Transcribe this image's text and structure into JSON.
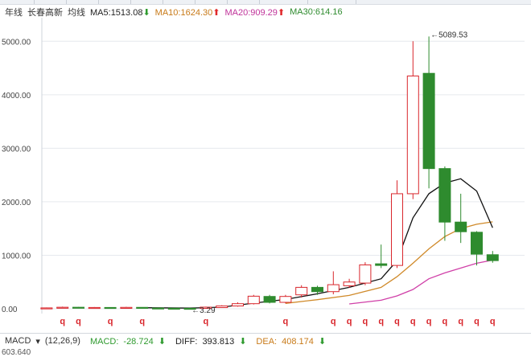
{
  "header": {
    "period": "年线",
    "stock": "长春高新",
    "indicator": "均线",
    "ma5": {
      "label": "MA5:",
      "value": "1513.08",
      "dir": "down"
    },
    "ma10": {
      "label": "MA10:",
      "value": "1624.30",
      "dir": "up"
    },
    "ma20": {
      "label": "MA20:",
      "value": "909.29",
      "dir": "up"
    },
    "ma30": {
      "label": "MA30:",
      "value": "614.16",
      "dir": ""
    }
  },
  "macd": {
    "name": "MACD",
    "params": "(12,26,9)",
    "macd_label": "MACD:",
    "macd_value": "-28.724",
    "macd_dir": "down",
    "diff_label": "DIFF:",
    "diff_value": "393.813",
    "diff_dir": "down",
    "dea_label": "DEA:",
    "dea_value": "408.174",
    "dea_dir": "down",
    "axis_top": "603.640"
  },
  "colors": {
    "up": "#d9262c",
    "down": "#2e8b2e",
    "up_fill": "#ffffff",
    "ma5": "#111111",
    "ma10": "#d08a2a",
    "ma20": "#d040a8",
    "grid": "#e6e9ee"
  },
  "chart_data": {
    "type": "candlestick",
    "title": "长春高新 年线",
    "ylim": [
      -30,
      5350
    ],
    "yticks": [
      0,
      1000,
      2000,
      3000,
      4000,
      5000
    ],
    "ytick_labels": [
      "0.00",
      "1000.00",
      "2000.00",
      "3000.00",
      "4000.00",
      "5000.00"
    ],
    "grid": true,
    "candles": [
      {
        "o": 8,
        "c": 16,
        "h": 24,
        "l": 4
      },
      {
        "o": 16,
        "c": 28,
        "h": 40,
        "l": 10
      },
      {
        "o": 28,
        "c": 20,
        "h": 34,
        "l": 14
      },
      {
        "o": 20,
        "c": 24,
        "h": 32,
        "l": 16
      },
      {
        "o": 24,
        "c": 18,
        "h": 28,
        "l": 10
      },
      {
        "o": 18,
        "c": 26,
        "h": 36,
        "l": 12
      },
      {
        "o": 26,
        "c": 14,
        "h": 30,
        "l": 8
      },
      {
        "o": 14,
        "c": 10,
        "h": 18,
        "l": 6
      },
      {
        "o": 10,
        "c": 8,
        "h": 14,
        "l": 4
      },
      {
        "o": 8,
        "c": 5,
        "h": 10,
        "l": 3.29
      },
      {
        "o": 8,
        "c": 30,
        "h": 40,
        "l": 6
      },
      {
        "o": 22,
        "c": 52,
        "h": 66,
        "l": 16
      },
      {
        "o": 52,
        "c": 95,
        "h": 120,
        "l": 40
      },
      {
        "o": 95,
        "c": 235,
        "h": 260,
        "l": 80
      },
      {
        "o": 230,
        "c": 120,
        "h": 260,
        "l": 100
      },
      {
        "o": 120,
        "c": 230,
        "h": 260,
        "l": 100
      },
      {
        "o": 260,
        "c": 400,
        "h": 440,
        "l": 210
      },
      {
        "o": 400,
        "c": 320,
        "h": 430,
        "l": 260
      },
      {
        "o": 320,
        "c": 450,
        "h": 700,
        "l": 270
      },
      {
        "o": 430,
        "c": 500,
        "h": 560,
        "l": 390
      },
      {
        "o": 480,
        "c": 820,
        "h": 870,
        "l": 440
      },
      {
        "o": 840,
        "c": 810,
        "h": 1200,
        "l": 760
      },
      {
        "o": 810,
        "c": 2150,
        "h": 2400,
        "l": 760
      },
      {
        "o": 2150,
        "c": 4350,
        "h": 5000,
        "l": 2050
      },
      {
        "o": 4400,
        "c": 2620,
        "h": 5089.53,
        "l": 2250
      },
      {
        "o": 2620,
        "c": 1620,
        "h": 2660,
        "l": 1270
      },
      {
        "o": 1620,
        "c": 1440,
        "h": 2150,
        "l": 1230
      },
      {
        "o": 1430,
        "c": 1020,
        "h": 1450,
        "l": 810
      },
      {
        "o": 1010,
        "c": 900,
        "h": 1080,
        "l": 860
      }
    ],
    "ma5": [
      {
        "i": 6,
        "v": 20
      },
      {
        "i": 9,
        "v": 12
      },
      {
        "i": 11,
        "v": 30
      },
      {
        "i": 13,
        "v": 105
      },
      {
        "i": 15,
        "v": 175
      },
      {
        "i": 17,
        "v": 280
      },
      {
        "i": 19,
        "v": 400
      },
      {
        "i": 21,
        "v": 560
      },
      {
        "i": 22,
        "v": 900
      },
      {
        "i": 23,
        "v": 1700
      },
      {
        "i": 24,
        "v": 2150
      },
      {
        "i": 25,
        "v": 2350
      },
      {
        "i": 26,
        "v": 2430
      },
      {
        "i": 27,
        "v": 2200
      },
      {
        "i": 28,
        "v": 1513.08
      }
    ],
    "ma10": [
      {
        "i": 15,
        "v": 100
      },
      {
        "i": 17,
        "v": 170
      },
      {
        "i": 19,
        "v": 250
      },
      {
        "i": 21,
        "v": 400
      },
      {
        "i": 22,
        "v": 600
      },
      {
        "i": 23,
        "v": 850
      },
      {
        "i": 24,
        "v": 1120
      },
      {
        "i": 25,
        "v": 1350
      },
      {
        "i": 26,
        "v": 1500
      },
      {
        "i": 27,
        "v": 1580
      },
      {
        "i": 28,
        "v": 1624.3
      }
    ],
    "ma20": [
      {
        "i": 19,
        "v": 90
      },
      {
        "i": 21,
        "v": 160
      },
      {
        "i": 22,
        "v": 240
      },
      {
        "i": 23,
        "v": 360
      },
      {
        "i": 24,
        "v": 560
      },
      {
        "i": 25,
        "v": 670
      },
      {
        "i": 26,
        "v": 760
      },
      {
        "i": 27,
        "v": 850
      },
      {
        "i": 28,
        "v": 909.29
      }
    ],
    "annotations": [
      {
        "label": "←3.29",
        "i": 9,
        "v": 3.29
      },
      {
        "label": "←5089.53",
        "i": 24,
        "v": 5089.53
      }
    ],
    "event_marker": "q",
    "event_indices": [
      1,
      2,
      4,
      6,
      10,
      15,
      18,
      19,
      20,
      21,
      22,
      23,
      24,
      25,
      26,
      27,
      28
    ]
  }
}
